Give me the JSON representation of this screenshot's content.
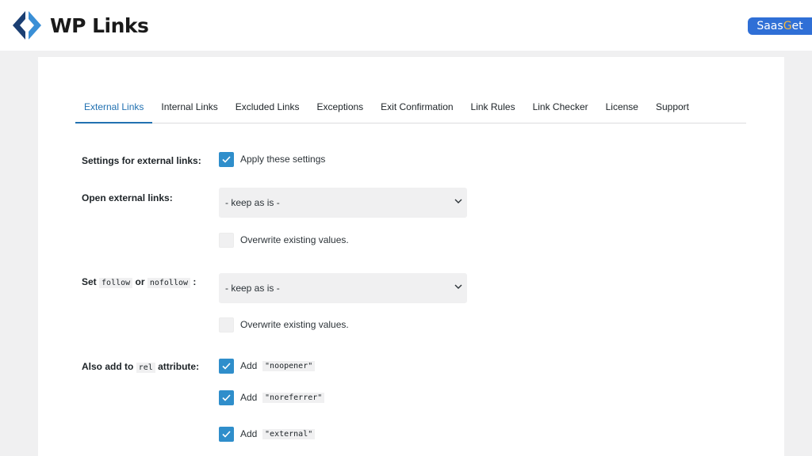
{
  "header": {
    "logo_text": "WP Links",
    "badge_prefix": "Saas",
    "badge_g": "G",
    "badge_suffix": "et",
    "colors": {
      "logo_dark": "#1b3f73",
      "logo_light": "#3a8fd6",
      "badge_bg": "#2f6fd6"
    }
  },
  "tabs": [
    {
      "label": "External Links",
      "active": true
    },
    {
      "label": "Internal Links",
      "active": false
    },
    {
      "label": "Excluded Links",
      "active": false
    },
    {
      "label": "Exceptions",
      "active": false
    },
    {
      "label": "Exit Confirmation",
      "active": false
    },
    {
      "label": "Link Rules",
      "active": false
    },
    {
      "label": "Link Checker",
      "active": false
    },
    {
      "label": "License",
      "active": false
    },
    {
      "label": "Support",
      "active": false
    }
  ],
  "settings": {
    "apply": {
      "label": "Settings for external links:",
      "checkbox_label": "Apply these settings",
      "checked": true
    },
    "open": {
      "label": "Open external links:",
      "select_value": "- keep as is -",
      "overwrite_label": "Overwrite existing values.",
      "overwrite_checked": false
    },
    "follow": {
      "label_prefix": "Set",
      "code_follow": "follow",
      "label_or": "or",
      "code_nofollow": "nofollow",
      "label_suffix": ":",
      "select_value": "- keep as is -",
      "overwrite_label": "Overwrite existing values.",
      "overwrite_checked": false
    },
    "rel": {
      "label_prefix": "Also add to",
      "code_rel": "rel",
      "label_suffix": "attribute:",
      "options": [
        {
          "add": "Add",
          "code": "\"noopener\"",
          "checked": true
        },
        {
          "add": "Add",
          "code": "\"noreferrer\"",
          "checked": true
        },
        {
          "add": "Add",
          "code": "\"external\"",
          "checked": true
        }
      ]
    }
  }
}
